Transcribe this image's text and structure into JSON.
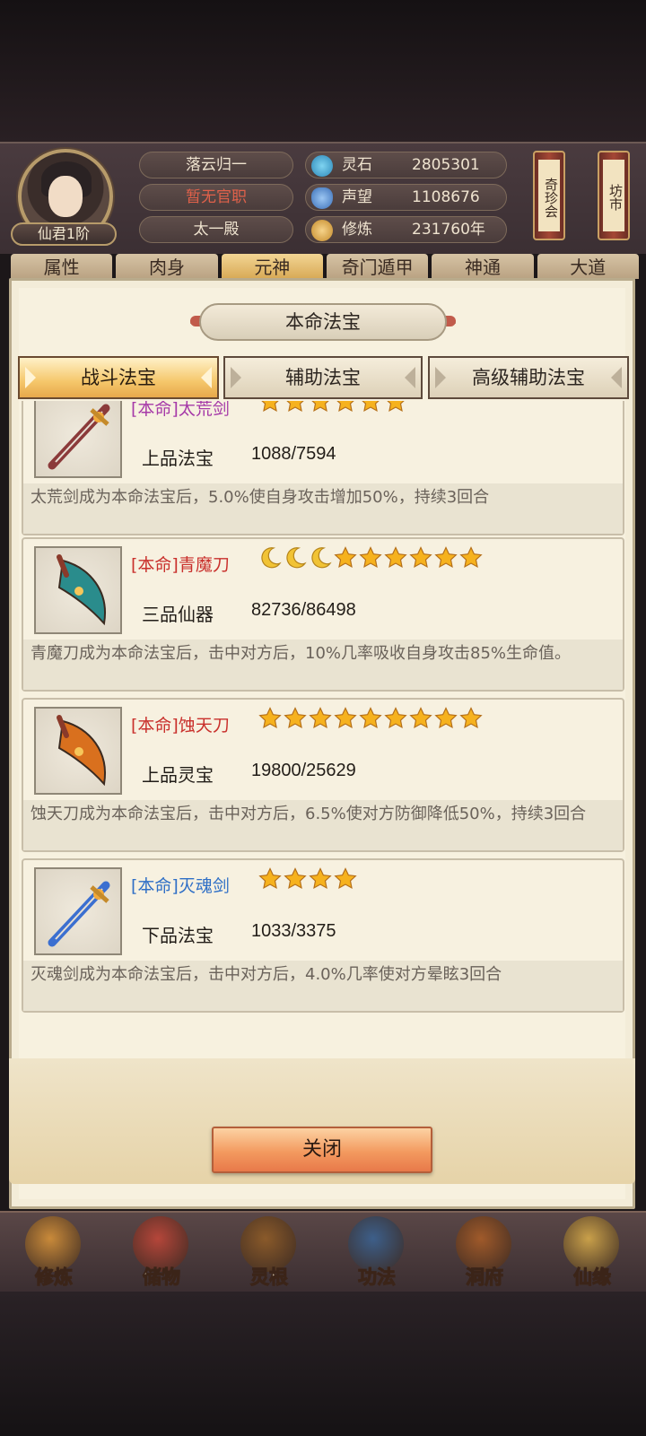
{
  "header": {
    "avatar_rank": "仙君1阶",
    "player_name": "落云归一",
    "official_post": "暂无官职",
    "sect": "太一殿",
    "resources": [
      {
        "label": "灵石",
        "value": "2805301",
        "icon": "spirit-stone-icon",
        "color": "#3fa7d6"
      },
      {
        "label": "声望",
        "value": "1108676",
        "icon": "reputation-crystal-icon",
        "color": "#4f8fd6"
      },
      {
        "label": "修炼",
        "value": "231760年",
        "icon": "meditation-icon",
        "color": "#e0a441"
      }
    ],
    "side_buttons": [
      "奇珍会",
      "坊市"
    ]
  },
  "main_tabs": [
    "属性",
    "肉身",
    "元神",
    "奇门遁甲",
    "神通",
    "大道"
  ],
  "panel": {
    "title": "本命法宝",
    "sub_tabs": [
      "战斗法宝",
      "辅助法宝",
      "高级辅助法宝"
    ],
    "active_sub_tab": 0,
    "close_label": "关闭"
  },
  "items": [
    {
      "name": "[本命]太荒剑",
      "name_color": "#a63aa8",
      "grade": "上品法宝",
      "exp": "1088/7594",
      "stars": 6,
      "moons": 0,
      "desc": "太荒剑成为本命法宝后，5.0%使自身攻击增加50%，持续3回合",
      "weapon": "sword",
      "color": "#8b3a3a"
    },
    {
      "name": "[本命]青魔刀",
      "name_color": "#c9302c",
      "grade": "三品仙器",
      "exp": "82736/86498",
      "stars": 6,
      "moons": 3,
      "desc": "青魔刀成为本命法宝后，击中对方后，10%几率吸收自身攻击85%生命值。",
      "weapon": "blade",
      "color": "#2a8c8c"
    },
    {
      "name": "[本命]蚀天刀",
      "name_color": "#c9302c",
      "grade": "上品灵宝",
      "exp": "19800/25629",
      "stars": 9,
      "moons": 0,
      "desc": "蚀天刀成为本命法宝后，击中对方后，6.5%使对方防御降低50%，持续3回合",
      "weapon": "blade",
      "color": "#d9701e"
    },
    {
      "name": "[本命]灭魂剑",
      "name_color": "#2f6fc6",
      "grade": "下品法宝",
      "exp": "1033/3375",
      "stars": 4,
      "moons": 0,
      "desc": "灭魂剑成为本命法宝后，击中对方后，4.0%几率使对方晕眩3回合",
      "weapon": "sword",
      "color": "#3b6fd0"
    }
  ],
  "bottom_nav": [
    {
      "label": "修炼",
      "icon": "cultivation-icon",
      "color": "#c98a3a"
    },
    {
      "label": "储物",
      "icon": "storage-bag-icon",
      "color": "#b5463a"
    },
    {
      "label": "灵根",
      "icon": "spirit-root-icon",
      "color": "#8a5a2a"
    },
    {
      "label": "功法",
      "icon": "technique-book-icon",
      "color": "#3d5f8a"
    },
    {
      "label": "洞府",
      "icon": "cave-dwelling-icon",
      "color": "#a05a2a"
    },
    {
      "label": "仙缘",
      "icon": "immortal-fate-icon",
      "color": "#c9a04a"
    }
  ]
}
